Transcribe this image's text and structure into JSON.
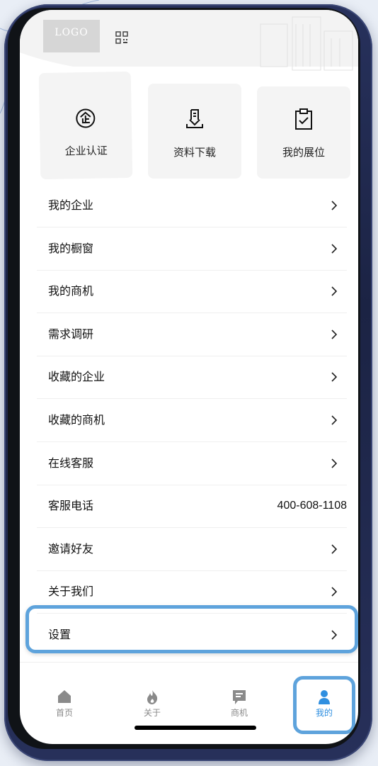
{
  "header": {
    "logo_text": "LOGO",
    "qr_icon": "qrcode-icon"
  },
  "quick_actions": [
    {
      "label": "企业认证",
      "icon": "enterprise-certification-icon"
    },
    {
      "label": "资料下载",
      "icon": "document-download-icon"
    },
    {
      "label": "我的展位",
      "icon": "clipboard-check-icon"
    }
  ],
  "menu": {
    "items": [
      {
        "label": "我的企业",
        "icon": "chevron-right-icon"
      },
      {
        "label": "我的橱窗",
        "icon": "chevron-right-icon"
      },
      {
        "label": "我的商机",
        "icon": "chevron-right-icon"
      },
      {
        "label": "需求调研",
        "icon": "chevron-right-icon"
      },
      {
        "label": "收藏的企业",
        "icon": "chevron-right-icon"
      },
      {
        "label": "收藏的商机",
        "icon": "chevron-right-icon"
      },
      {
        "label": "在线客服",
        "icon": "chevron-right-icon"
      },
      {
        "label": "客服电话",
        "value": "400-608-1108"
      },
      {
        "label": "邀请好友",
        "icon": "chevron-right-icon"
      },
      {
        "label": "关于我们",
        "icon": "chevron-right-icon"
      },
      {
        "label": "设置",
        "icon": "chevron-right-icon"
      }
    ]
  },
  "tabbar": {
    "tabs": [
      {
        "label": "首页",
        "icon": "home-icon"
      },
      {
        "label": "关于",
        "icon": "flame-icon"
      },
      {
        "label": "商机",
        "icon": "message-list-icon"
      },
      {
        "label": "我的",
        "icon": "user-icon",
        "active": true
      }
    ]
  },
  "colors": {
    "accent": "#2f8fe0",
    "highlight_border": "#5ea3dc",
    "frame": "#1b2344",
    "card_bg": "#f4f4f4"
  }
}
